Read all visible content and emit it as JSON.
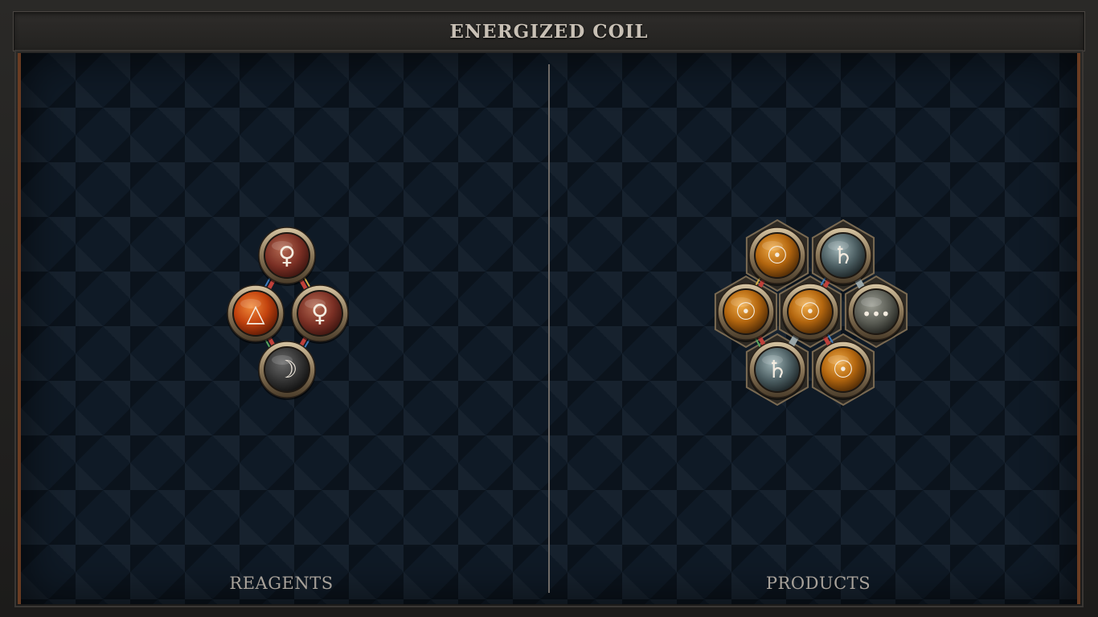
{
  "title": "ENERGIZED COIL",
  "reagents": {
    "label": "REAGENTS",
    "atoms": [
      {
        "symbol": "♀",
        "element": "copper",
        "color": "#8a3a2e"
      },
      {
        "symbol": "△",
        "element": "fire",
        "color": "#c24a14"
      },
      {
        "symbol": "♀",
        "element": "copper",
        "color": "#8a3a2e"
      },
      {
        "symbol": "☽",
        "element": "silver",
        "color": "#3d3d3d"
      }
    ]
  },
  "products": {
    "label": "PRODUCTS",
    "atoms": [
      {
        "symbol": "☉",
        "element": "gold",
        "color": "#b86b18"
      },
      {
        "symbol": "♄",
        "element": "lead",
        "color": "#4f6268"
      },
      {
        "symbol": "☉",
        "element": "gold",
        "color": "#b86b18"
      },
      {
        "symbol": "☉",
        "element": "gold",
        "color": "#b86b18"
      },
      {
        "symbol": "•••",
        "element": "quicksilver",
        "color": "#5b5d55"
      },
      {
        "symbol": "♄",
        "element": "lead",
        "color": "#4f6268"
      },
      {
        "symbol": "☉",
        "element": "gold",
        "color": "#b86b18"
      }
    ]
  }
}
